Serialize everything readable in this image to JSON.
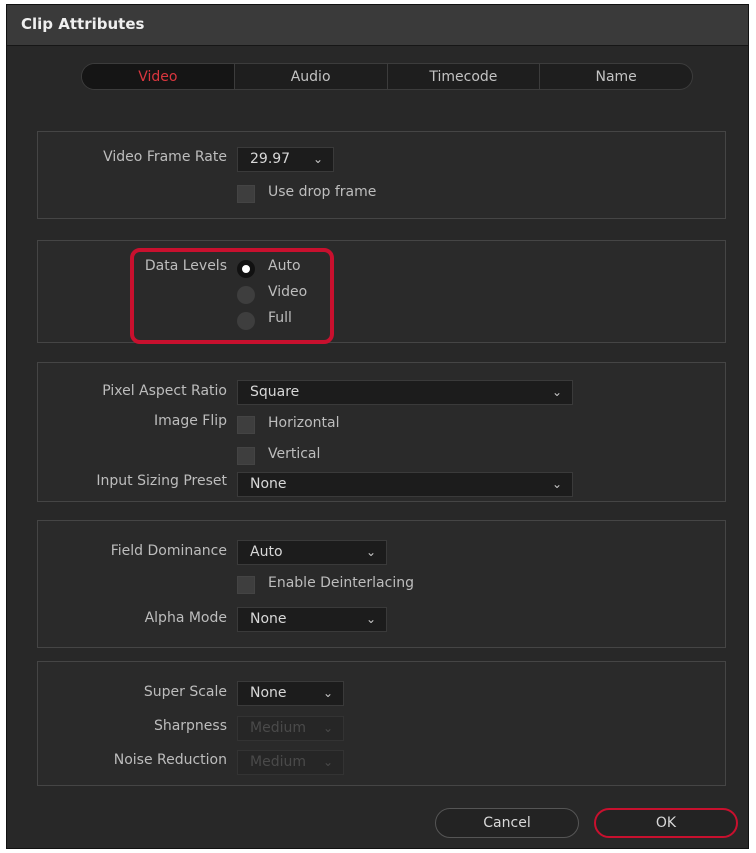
{
  "window": {
    "title": "Clip Attributes"
  },
  "tabs": [
    {
      "label": "Video"
    },
    {
      "label": "Audio"
    },
    {
      "label": "Timecode"
    },
    {
      "label": "Name"
    }
  ],
  "frame_rate": {
    "label": "Video Frame Rate",
    "value": "29.97",
    "drop_frame_label": "Use drop frame",
    "drop_frame_checked": false
  },
  "data_levels": {
    "label": "Data Levels",
    "options": [
      "Auto",
      "Video",
      "Full"
    ],
    "selected": "Auto"
  },
  "pixel": {
    "aspect_label": "Pixel Aspect Ratio",
    "aspect_value": "Square",
    "flip_label": "Image Flip",
    "flip_horizontal": "Horizontal",
    "flip_vertical": "Vertical",
    "sizing_label": "Input Sizing Preset",
    "sizing_value": "None"
  },
  "field": {
    "dominance_label": "Field Dominance",
    "dominance_value": "Auto",
    "deinterlace_label": "Enable Deinterlacing",
    "alpha_label": "Alpha Mode",
    "alpha_value": "None"
  },
  "scale": {
    "super_label": "Super Scale",
    "super_value": "None",
    "sharpness_label": "Sharpness",
    "sharpness_value": "Medium",
    "noise_label": "Noise Reduction",
    "noise_value": "Medium"
  },
  "buttons": {
    "cancel": "Cancel",
    "ok": "OK"
  },
  "colors": {
    "accent": "#c8102e",
    "active_tab": "#d9363e",
    "background": "#282828"
  }
}
